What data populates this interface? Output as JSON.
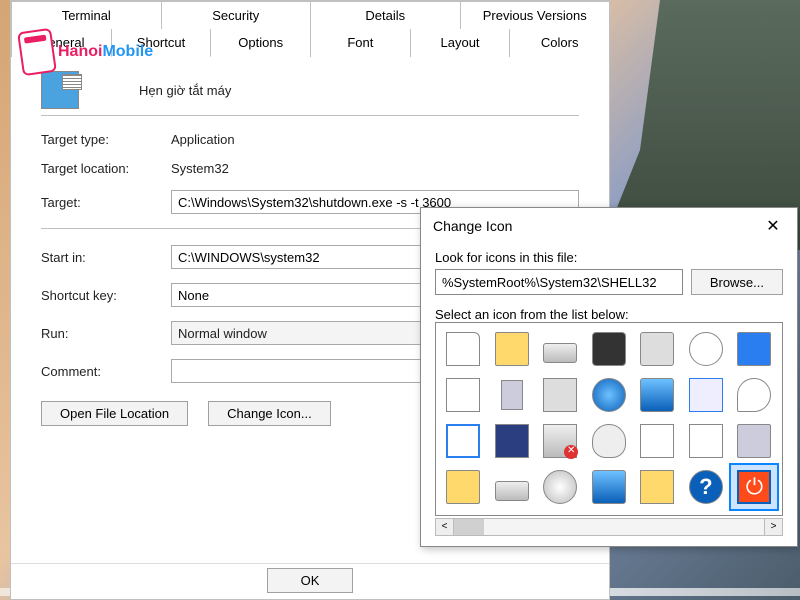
{
  "logo": {
    "text_h": "Hanoi",
    "text_b": "Mobile",
    "name": "hanoimobile-logo"
  },
  "tabs_row1": [
    "Terminal",
    "Security",
    "Details",
    "Previous Versions"
  ],
  "tabs_row2": [
    "General",
    "Shortcut",
    "Options",
    "Font",
    "Layout",
    "Colors"
  ],
  "active_tab": "Shortcut",
  "shortcut": {
    "name": "Hẹn giờ tắt máy",
    "target_type_label": "Target type:",
    "target_type": "Application",
    "target_location_label": "Target location:",
    "target_location": "System32",
    "target_label": "Target:",
    "target": "C:\\Windows\\System32\\shutdown.exe -s -t 3600",
    "start_in_label": "Start in:",
    "start_in": "C:\\WINDOWS\\system32",
    "shortcut_key_label": "Shortcut key:",
    "shortcut_key": "None",
    "run_label": "Run:",
    "run": "Normal window",
    "comment_label": "Comment:",
    "comment": ""
  },
  "buttons": {
    "open_file_location": "Open File Location",
    "change_icon": "Change Icon...",
    "ok": "OK"
  },
  "change_icon": {
    "title": "Change Icon",
    "look_label": "Look for icons in this file:",
    "path": "%SystemRoot%\\System32\\SHELL32",
    "browse": "Browse...",
    "select_label": "Select an icon from the list below:",
    "selected_index": 27,
    "icons": [
      "blank-document-icon",
      "folder-icon",
      "hard-drive-icon",
      "chip-icon",
      "printer-icon",
      "clock-document-icon",
      "display-icon",
      "text-document-icon",
      "computer-tower-icon",
      "network-drive-icon",
      "internet-globe-icon",
      "monitor-icon",
      "control-panel-icon",
      "search-icon",
      "window-icon",
      "floppy-disk-icon",
      "drive-error-icon",
      "mouse-icon",
      "network-nodes-icon",
      "chart-icon",
      "usb-drive-icon",
      "folder-open-icon",
      "drive-alt-icon",
      "optical-disc-icon",
      "monitor-alt-icon",
      "keypad-icon",
      "help-icon",
      "power-icon"
    ]
  }
}
